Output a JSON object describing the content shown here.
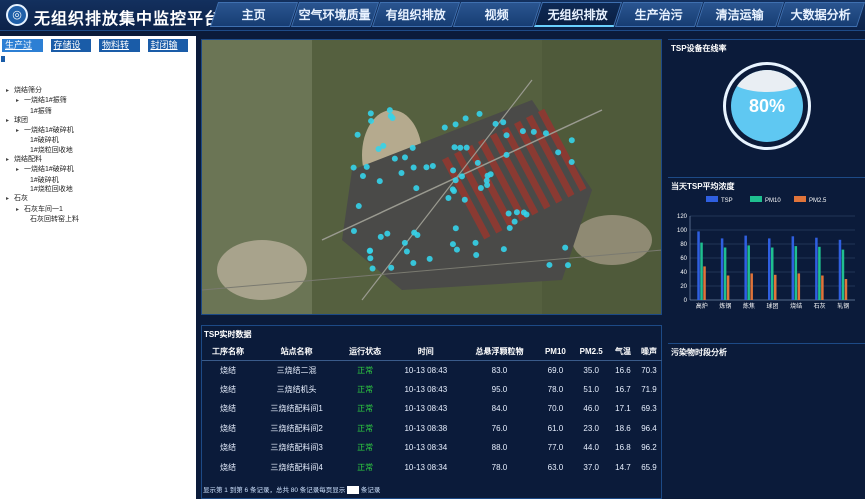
{
  "header": {
    "logo_glyph": "◎",
    "title": "无组织排放集中监控平台",
    "tabs": [
      {
        "label": "主页"
      },
      {
        "label": "空气环境质量"
      },
      {
        "label": "有组织排放"
      },
      {
        "label": "视频"
      },
      {
        "label": "无组织排放",
        "active": true
      },
      {
        "label": "生产治污"
      },
      {
        "label": "清洁运输"
      },
      {
        "label": "大数据分析"
      }
    ]
  },
  "left": {
    "subtabs": [
      "生产过程",
      "存储设施",
      "物料转运",
      "封闭输运"
    ],
    "tree": [
      {
        "level": 1,
        "caret": true,
        "label": "烧结筛分"
      },
      {
        "level": 2,
        "caret": true,
        "label": "一烧结1#振筛"
      },
      {
        "level": 3,
        "caret": false,
        "label": "1#振筛"
      },
      {
        "level": 1,
        "caret": true,
        "label": "球团"
      },
      {
        "level": 2,
        "caret": true,
        "label": "一烧结1#破碎机"
      },
      {
        "level": 3,
        "caret": false,
        "label": "1#破碎机"
      },
      {
        "level": 3,
        "caret": false,
        "label": "1#烧粒回收地"
      },
      {
        "level": 1,
        "caret": true,
        "label": "烧结配料"
      },
      {
        "level": 2,
        "caret": true,
        "label": "一烧结1#破碎机"
      },
      {
        "level": 3,
        "caret": false,
        "label": "1#破碎机"
      },
      {
        "level": 3,
        "caret": false,
        "label": "1#烧粒回收地"
      },
      {
        "level": 1,
        "caret": true,
        "label": "石灰"
      },
      {
        "level": 2,
        "caret": true,
        "label": "石灰车间一1"
      },
      {
        "level": 3,
        "caret": false,
        "label": "石灰回转窑上料"
      }
    ]
  },
  "map": {
    "marker_color": "#35d3ea",
    "markers_count": 80
  },
  "tsp_table": {
    "title": "TSP实时数据",
    "columns": [
      "工序名称",
      "站点名称",
      "运行状态",
      "时间",
      "总悬浮颗粒物",
      "PM10",
      "PM2.5",
      "气温",
      "噪声"
    ],
    "rows": [
      [
        "烧结",
        "三烧结二混",
        "正常",
        "10-13 08:43",
        "83.0",
        "69.0",
        "35.0",
        "16.6",
        "70.3"
      ],
      [
        "烧结",
        "三烧结机头",
        "正常",
        "10-13 08:43",
        "95.0",
        "78.0",
        "51.0",
        "16.7",
        "71.9"
      ],
      [
        "烧结",
        "三烧结配料间1",
        "正常",
        "10-13 08:43",
        "84.0",
        "70.0",
        "46.0",
        "17.1",
        "69.3"
      ],
      [
        "烧结",
        "三烧结配料间2",
        "正常",
        "10-13 08:38",
        "76.0",
        "61.0",
        "23.0",
        "18.6",
        "96.4"
      ],
      [
        "烧结",
        "三烧结配料间3",
        "正常",
        "10-13 08:34",
        "88.0",
        "77.0",
        "44.0",
        "16.8",
        "96.2"
      ],
      [
        "烧结",
        "三烧结配料间4",
        "正常",
        "10-13 08:34",
        "78.0",
        "63.0",
        "37.0",
        "14.7",
        "65.9"
      ]
    ],
    "footer_text": "显示第 1 到第 6 条记录，总共 80 条记录每页显示",
    "footer_tail": "条记录"
  },
  "online_rate": {
    "title": "TSP设备在线率",
    "value_text": "80%",
    "value": 0.8
  },
  "avg_chart": {
    "title": "当天TSP平均浓度"
  },
  "pollution": {
    "title": "污染物时段分析"
  },
  "chart_data": {
    "type": "bar",
    "categories": [
      "高炉",
      "炼钢",
      "炼焦",
      "球团",
      "烧结",
      "石灰",
      "轧钢"
    ],
    "series": [
      {
        "name": "TSP",
        "color": "#2f5fe0",
        "values": [
          98,
          88,
          92,
          88,
          91,
          89,
          86
        ]
      },
      {
        "name": "PM10",
        "color": "#1fbf8f",
        "values": [
          82,
          75,
          78,
          75,
          77,
          76,
          72
        ]
      },
      {
        "name": "PM2.5",
        "color": "#e0743a",
        "values": [
          48,
          35,
          38,
          36,
          38,
          35,
          30
        ]
      }
    ],
    "ylim": [
      0,
      120
    ],
    "yticks": [
      0,
      20,
      40,
      60,
      80,
      100,
      120
    ],
    "grid": true,
    "legend": "top"
  }
}
